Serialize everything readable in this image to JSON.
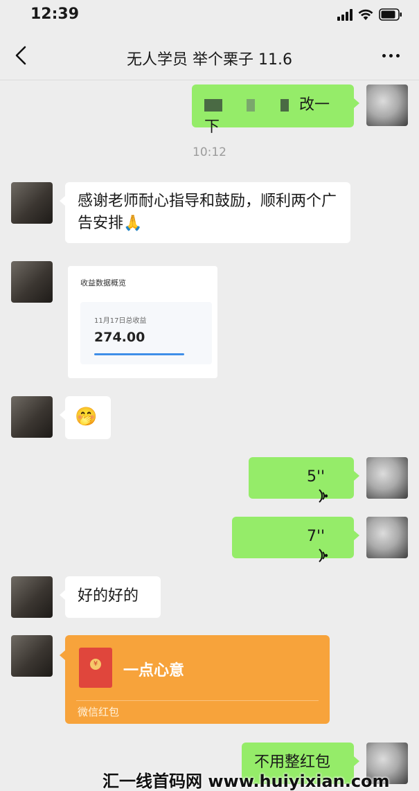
{
  "status_bar": {
    "time": "12:39"
  },
  "nav": {
    "title": "无人学员 举个栗子 11.6"
  },
  "messages": {
    "m1": {
      "suffix": "改一下"
    },
    "time_separator": "10:12",
    "m2": {
      "text": "感谢老师耐心指导和鼓励，顺利两个广告安排🙏"
    },
    "m3": {
      "title": "收益数据概览",
      "subtitle": "11月17日总收益",
      "amount": "274.00"
    },
    "m4": {
      "emoji": "🤭"
    },
    "m5": {
      "duration": "5''"
    },
    "m6": {
      "duration": "7''"
    },
    "m7": {
      "text": "好的好的"
    },
    "m8": {
      "title": "一点心意",
      "label": "微信红包"
    },
    "m9": {
      "text": "不用整红包"
    }
  },
  "watermark": "汇一线首码网 www.huiyixian.com",
  "colors": {
    "outgoing_bubble": "#95ec69",
    "incoming_bubble": "#ffffff",
    "red_packet": "#f7a33b"
  }
}
